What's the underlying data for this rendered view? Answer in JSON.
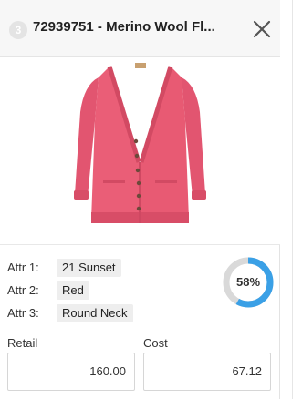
{
  "item": {
    "position_badge": "3",
    "title": "72939751 - Merino Wool Fl...",
    "close_icon": "close-icon",
    "image_icon": "cardigan-product-image"
  },
  "attributes": [
    {
      "label": "Attr 1:",
      "value": "21 Sunset"
    },
    {
      "label": "Attr 2:",
      "value": "Red"
    },
    {
      "label": "Attr 3:",
      "value": "Round Neck"
    }
  ],
  "progress": {
    "percent": 58,
    "label": "58%",
    "color": "#3aa0e6",
    "track_color": "#d9d9d9"
  },
  "pricing": {
    "retail_label": "Retail",
    "retail_value": "160.00",
    "cost_label": "Cost",
    "cost_value": "67.12"
  },
  "colors": {
    "header_bg": "#f7f7f7",
    "product_color": "#e85a73"
  }
}
